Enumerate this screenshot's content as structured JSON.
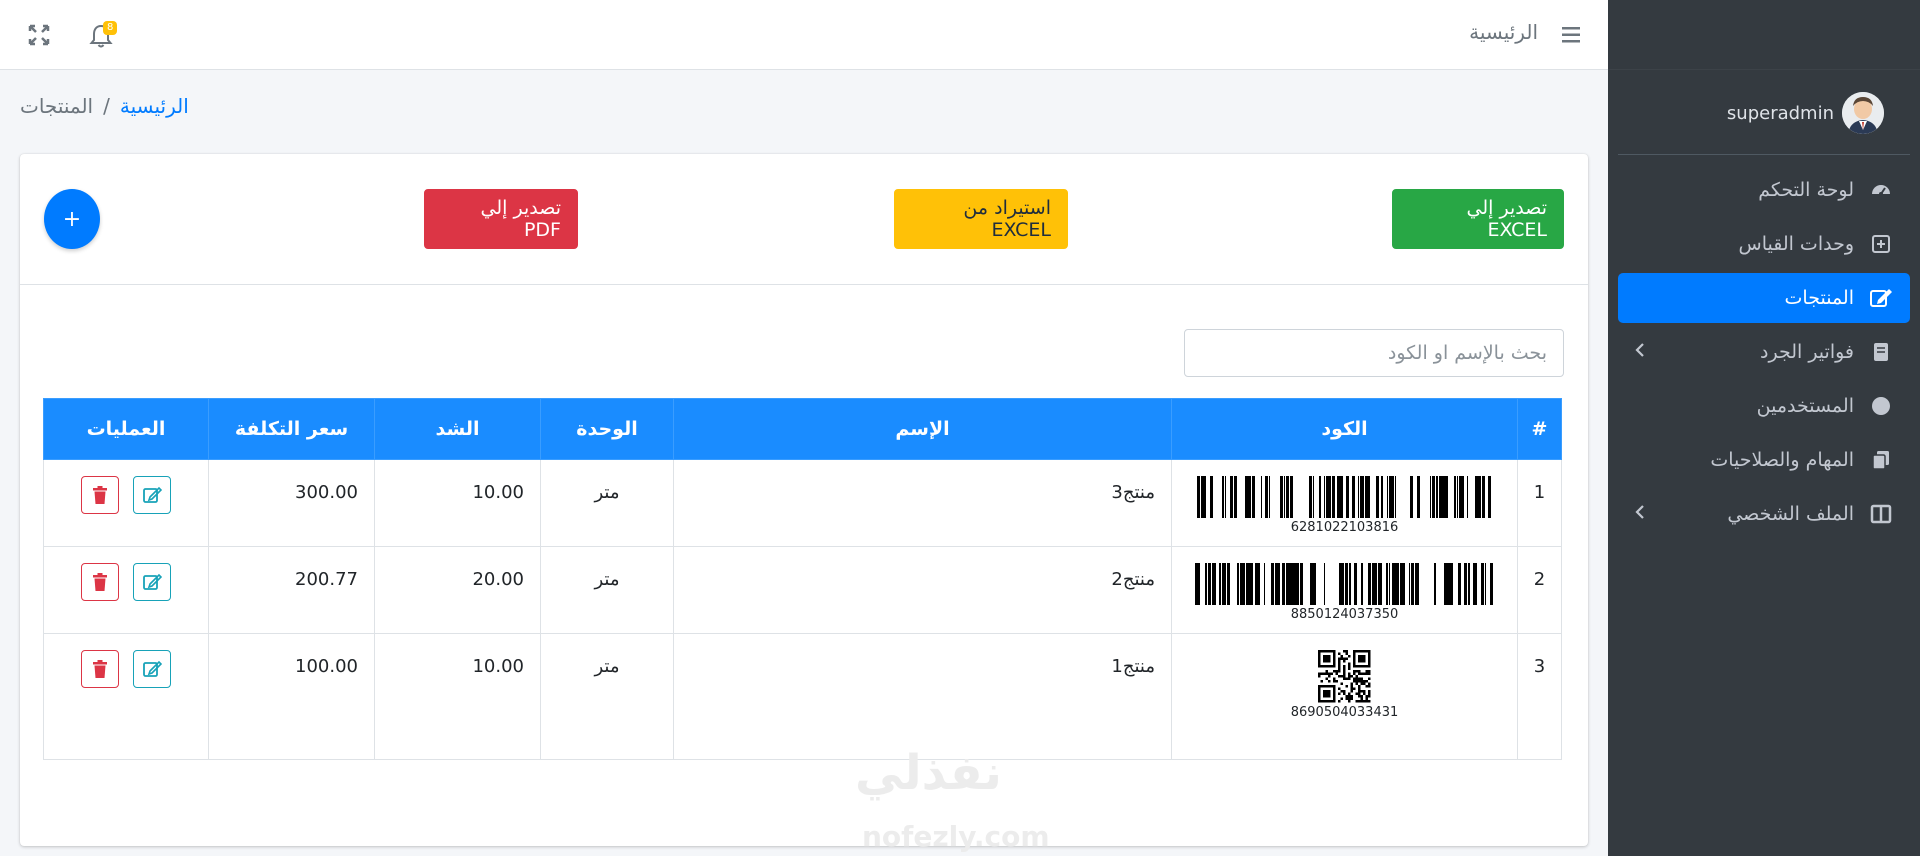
{
  "topbar": {
    "home_label": "الرئيسية",
    "notifications_count": "8"
  },
  "breadcrumb": {
    "home": "الرئيسية",
    "separator": "/",
    "current": "المنتجات"
  },
  "sidebar": {
    "user_name": "superadmin",
    "items": [
      {
        "label": "لوحة التحكم",
        "icon": "gauge-icon"
      },
      {
        "label": "وحدات القياس",
        "icon": "plus-square-icon"
      },
      {
        "label": "المنتجات",
        "icon": "edit-icon",
        "active": true
      },
      {
        "label": "فواتير الجرد",
        "icon": "book-icon"
      },
      {
        "label": "المستخدمين",
        "icon": "circle-icon"
      },
      {
        "label": "المهام والصلاحيات",
        "icon": "copy-icon"
      },
      {
        "label": "الملف الشخصي",
        "icon": "columns-icon"
      }
    ]
  },
  "actions": {
    "export_excel": "تصدير إلي EXCEL",
    "import_excel": "استيراد من EXCEL",
    "export_pdf": "تصدير إلي PDF",
    "add": "+"
  },
  "search": {
    "placeholder": "بحث بالإسم او الكود"
  },
  "table": {
    "headers": {
      "index": "#",
      "code": "الكود",
      "name": "الإسم",
      "unit": "الوحدة",
      "qty": "الشد",
      "cost": "سعر التكلفة",
      "ops": "العمليات"
    },
    "rows": [
      {
        "index": "1",
        "code": "6281022103816",
        "name": "منتج3",
        "unit": "متر",
        "qty": "10.00",
        "cost": "300.00",
        "code_type": "barcode"
      },
      {
        "index": "2",
        "code": "8850124037350",
        "name": "منتج2",
        "unit": "متر",
        "qty": "20.00",
        "cost": "200.77",
        "code_type": "barcode"
      },
      {
        "index": "3",
        "code": "8690504033431",
        "name": "منتج1",
        "unit": "متر",
        "qty": "10.00",
        "cost": "100.00",
        "code_type": "qr"
      }
    ]
  },
  "watermark": {
    "arabic": "نفذلي",
    "latin": "nofezly.com"
  },
  "colors": {
    "primary": "#007bff",
    "success": "#28a745",
    "warning": "#ffc107",
    "danger": "#dc3545",
    "info": "#17a2b8",
    "sidebar_bg": "#343a40"
  }
}
